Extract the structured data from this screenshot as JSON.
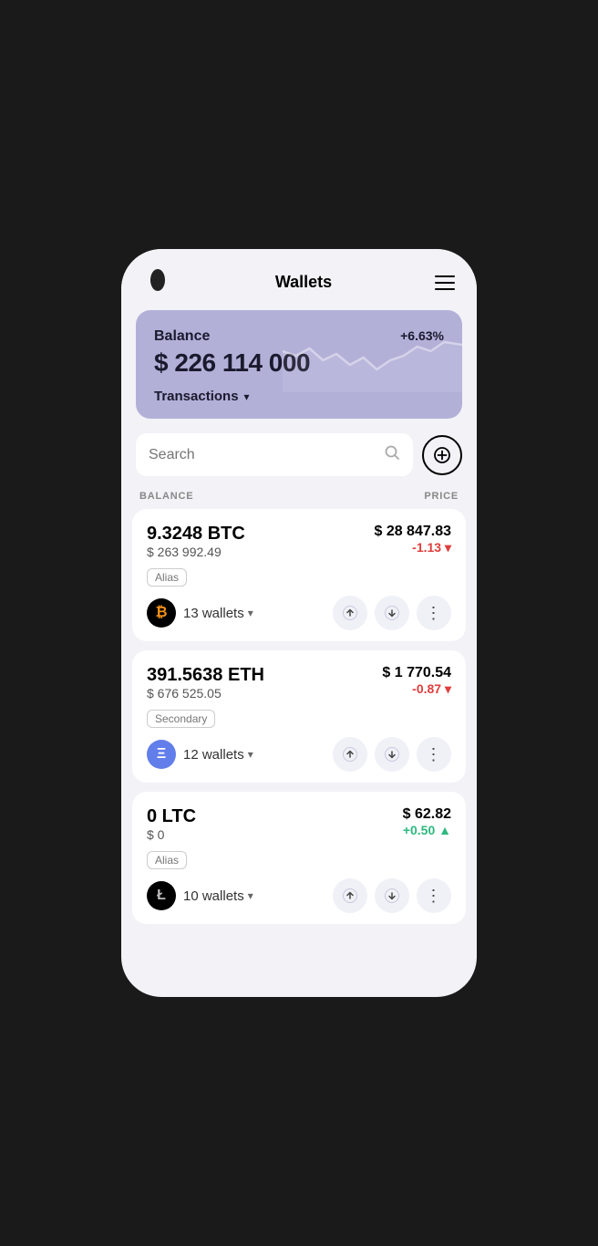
{
  "header": {
    "title": "Wallets",
    "menu_label": "menu"
  },
  "balance_card": {
    "label": "Balance",
    "percent": "+6.63%",
    "amount": "$ 226 114 000",
    "transactions_label": "Transactions"
  },
  "search": {
    "placeholder": "Search",
    "add_tooltip": "Add wallet"
  },
  "list": {
    "balance_col": "BALANCE",
    "price_col": "PRICE"
  },
  "coins": [
    {
      "id": "btc",
      "amount": "9.3248 BTC",
      "usd_value": "$ 263 992.49",
      "price": "$ 28 847.83",
      "change": "-1.13",
      "change_type": "neg",
      "alias": "Alias",
      "wallets": "13 wallets",
      "logo_color": "#000",
      "logo_symbol": "₿"
    },
    {
      "id": "eth",
      "amount": "391.5638 ETH",
      "usd_value": "$ 676 525.05",
      "price": "$ 1 770.54",
      "change": "-0.87",
      "change_type": "neg",
      "alias": "Secondary",
      "wallets": "12 wallets",
      "logo_color": "#627eea",
      "logo_symbol": "Ξ"
    },
    {
      "id": "ltc",
      "amount": "0 LTC",
      "usd_value": "$ 0",
      "price": "$ 62.82",
      "change": "+0.50",
      "change_type": "pos",
      "alias": "Alias",
      "wallets": "10 wallets",
      "logo_color": "#bfbbbb",
      "logo_symbol": "Ł"
    }
  ]
}
